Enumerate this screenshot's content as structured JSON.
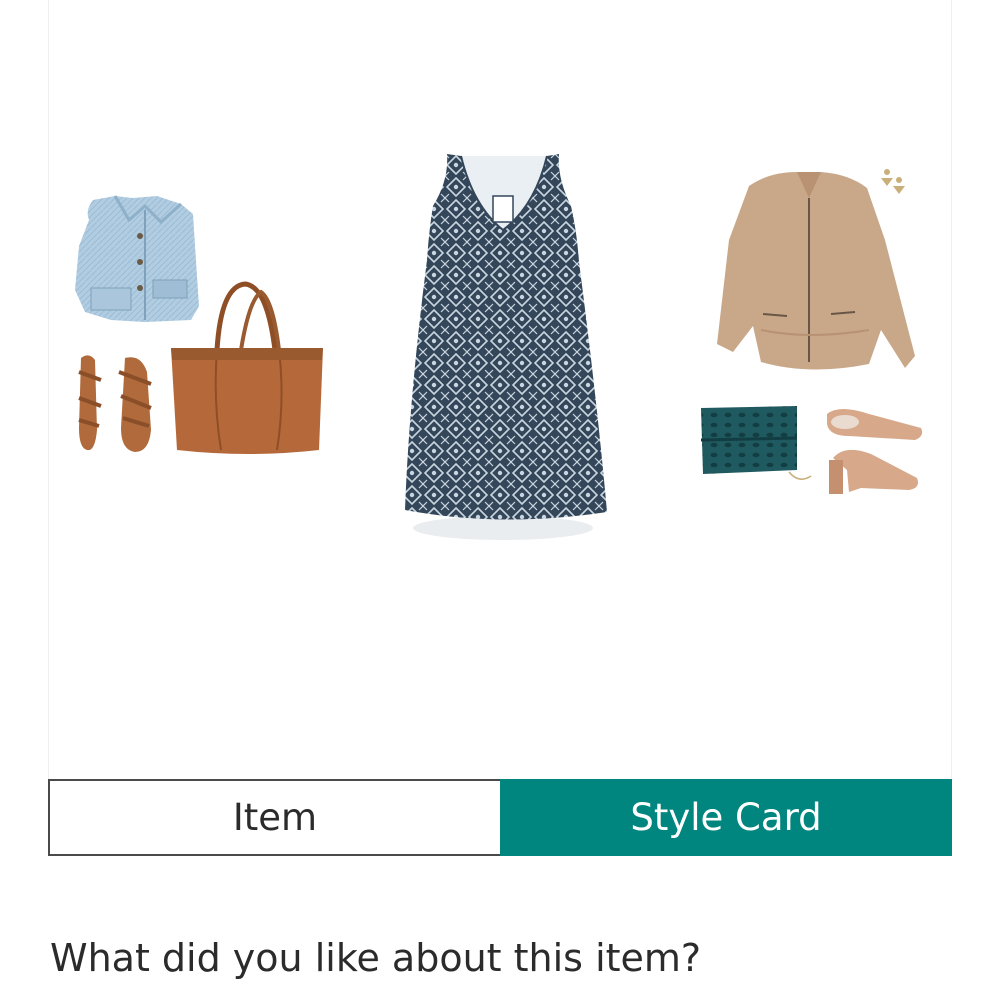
{
  "style_card": {
    "items": [
      {
        "name": "denim-jacket",
        "color": "#a9c6dd"
      },
      {
        "name": "tan-sandals",
        "color": "#b06a3c"
      },
      {
        "name": "cognac-tote",
        "color": "#b5693a"
      },
      {
        "name": "printed-dress",
        "color": "#3a4a5e"
      },
      {
        "name": "suede-jacket",
        "color": "#c9a88a"
      },
      {
        "name": "drop-earrings",
        "color": "#c9b07a"
      },
      {
        "name": "teal-clutch",
        "color": "#1f5a60"
      },
      {
        "name": "blush-mules",
        "color": "#d7a889"
      }
    ]
  },
  "tabs": {
    "item_label": "Item",
    "style_card_label": "Style Card",
    "active": "Style Card",
    "accent_color": "#00857f"
  },
  "question": {
    "text": "What did you like about this item?"
  }
}
